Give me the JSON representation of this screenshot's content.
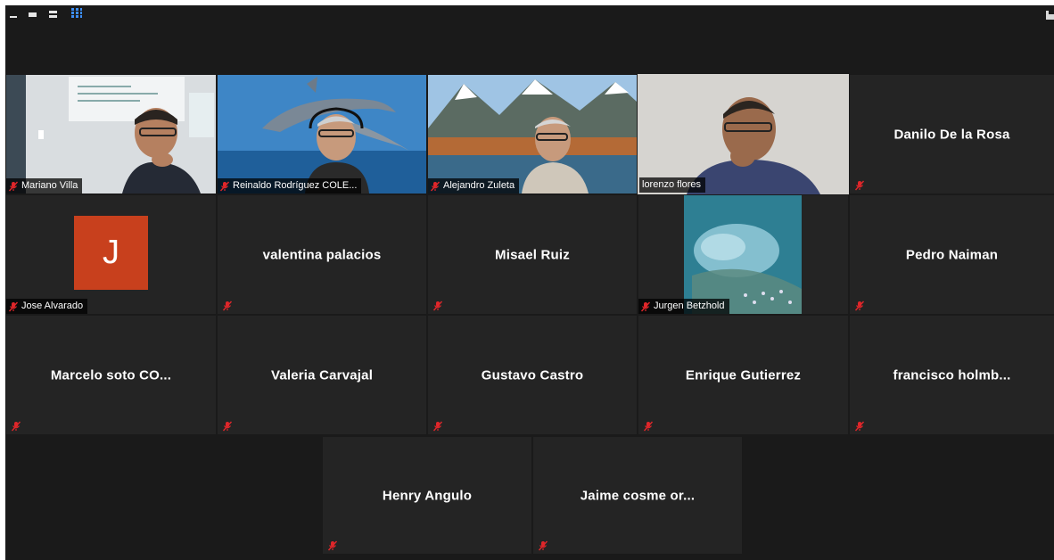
{
  "toolbar": {
    "icons": [
      "minimize-icon",
      "strip-view-icon",
      "speaker-view-icon",
      "gallery-view-icon",
      "fullscreen-icon"
    ],
    "active_view": "gallery"
  },
  "colors": {
    "background": "#1a1a1a",
    "tile": "#242424",
    "active_speaker_border": "#c8e35a",
    "muted_icon": "#e0262a",
    "avatar": "#c8401d",
    "gallery_icon": "#3d8ef5"
  },
  "participants": [
    {
      "name": "Mariano Villa",
      "video": true,
      "muted": true
    },
    {
      "name": "Reinaldo Rodríguez  COLE...",
      "video": true,
      "muted": true
    },
    {
      "name": "Alejandro Zuleta",
      "video": true,
      "muted": true
    },
    {
      "name": "lorenzo flores",
      "video": true,
      "muted": false,
      "active_speaker": true
    },
    {
      "name": "Danilo De la Rosa",
      "video": false,
      "muted": true
    },
    {
      "name": "Jose Alvarado",
      "video": false,
      "avatar_letter": "J",
      "muted": true
    },
    {
      "name": "valentina palacios",
      "video": false,
      "muted": true
    },
    {
      "name": "Misael Ruiz",
      "video": false,
      "muted": true
    },
    {
      "name": "Jurgen Betzhold",
      "video": true,
      "muted": true
    },
    {
      "name": "Pedro Naiman",
      "video": false,
      "muted": true
    },
    {
      "name": "Marcelo soto CO...",
      "video": false,
      "muted": true
    },
    {
      "name": "Valeria Carvajal",
      "video": false,
      "muted": true
    },
    {
      "name": "Gustavo Castro",
      "video": false,
      "muted": true
    },
    {
      "name": "Enrique Gutierrez",
      "video": false,
      "muted": true
    },
    {
      "name": "francisco  holmb...",
      "video": false,
      "muted": true
    },
    {
      "name": "Henry Angulo",
      "video": false,
      "muted": true
    },
    {
      "name": "Jaime cosme or...",
      "video": false,
      "muted": true
    }
  ]
}
